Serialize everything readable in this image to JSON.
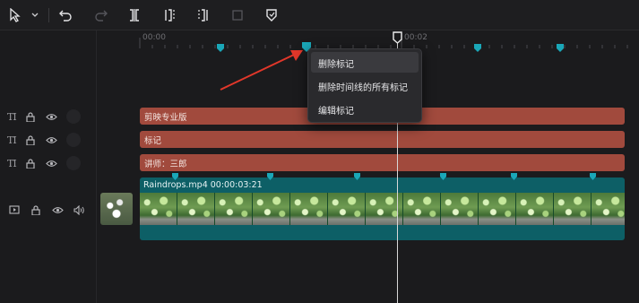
{
  "ruler": {
    "start_label": "00:00",
    "mid_label": "00:02"
  },
  "context_menu": {
    "items": [
      {
        "label": "删除标记"
      },
      {
        "label": "删除时间线的所有标记"
      },
      {
        "label": "编辑标记"
      }
    ]
  },
  "tracks": {
    "text_clips": [
      {
        "label": "剪映专业版"
      },
      {
        "label": "标记"
      },
      {
        "label": "讲师：三郎"
      }
    ],
    "video_clip": {
      "label": "Raindrops.mp4   00:00:03:21"
    }
  },
  "colors": {
    "marker": "#1aa7b8",
    "text_clip": "#a14a3d",
    "video_clip": "#0d5f66",
    "arrow": "#e2372a"
  },
  "icons": [
    "select-cursor-icon",
    "chevron-down-icon",
    "undo-icon",
    "redo-icon",
    "split-icon",
    "split-left-icon",
    "split-right-icon",
    "delete-icon",
    "marker-icon"
  ]
}
